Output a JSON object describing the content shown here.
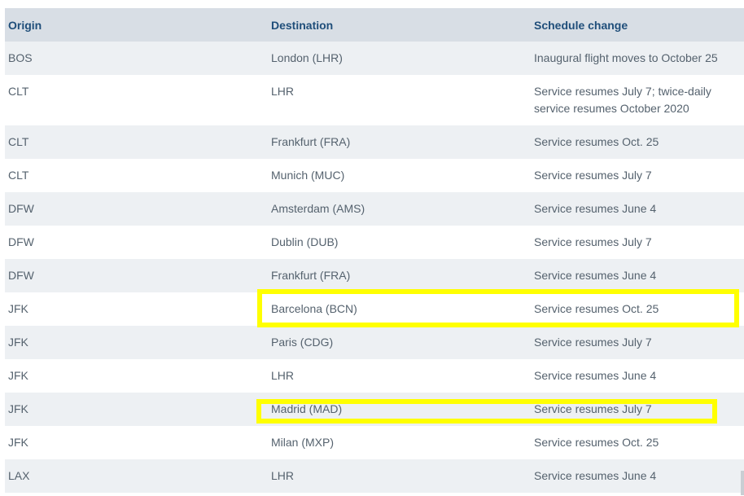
{
  "table": {
    "headers": {
      "origin": "Origin",
      "destination": "Destination",
      "schedule_change": "Schedule change"
    },
    "rows": [
      {
        "origin": "BOS",
        "destination": "London (LHR)",
        "schedule_change": "Inaugural flight moves to October 25"
      },
      {
        "origin": "CLT",
        "destination": "LHR",
        "schedule_change": "Service resumes July 7; twice-daily service resumes October 2020"
      },
      {
        "origin": "CLT",
        "destination": "Frankfurt (FRA)",
        "schedule_change": "Service resumes Oct. 25"
      },
      {
        "origin": "CLT",
        "destination": "Munich (MUC)",
        "schedule_change": "Service resumes July 7"
      },
      {
        "origin": "DFW",
        "destination": "Amsterdam (AMS)",
        "schedule_change": "Service resumes June 4"
      },
      {
        "origin": "DFW",
        "destination": "Dublin (DUB)",
        "schedule_change": "Service resumes July 7"
      },
      {
        "origin": "DFW",
        "destination": "Frankfurt (FRA)",
        "schedule_change": "Service resumes June 4"
      },
      {
        "origin": "JFK",
        "destination": "Barcelona (BCN)",
        "schedule_change": "Service resumes Oct. 25"
      },
      {
        "origin": "JFK",
        "destination": "Paris (CDG)",
        "schedule_change": "Service resumes July 7"
      },
      {
        "origin": "JFK",
        "destination": "LHR",
        "schedule_change": "Service resumes June 4"
      },
      {
        "origin": "JFK",
        "destination": "Madrid (MAD)",
        "schedule_change": "Service resumes July 7"
      },
      {
        "origin": "JFK",
        "destination": "Milan (MXP)",
        "schedule_change": "Service resumes Oct. 25"
      },
      {
        "origin": "LAX",
        "destination": "LHR",
        "schedule_change": "Service resumes June 4"
      }
    ]
  },
  "colors": {
    "header_bg": "#d8dee5",
    "header_text": "#1f4e7a",
    "row_shaded": "#edf0f3",
    "row_plain": "#ffffff",
    "body_text": "#55626e",
    "highlight": "#ffff00"
  }
}
